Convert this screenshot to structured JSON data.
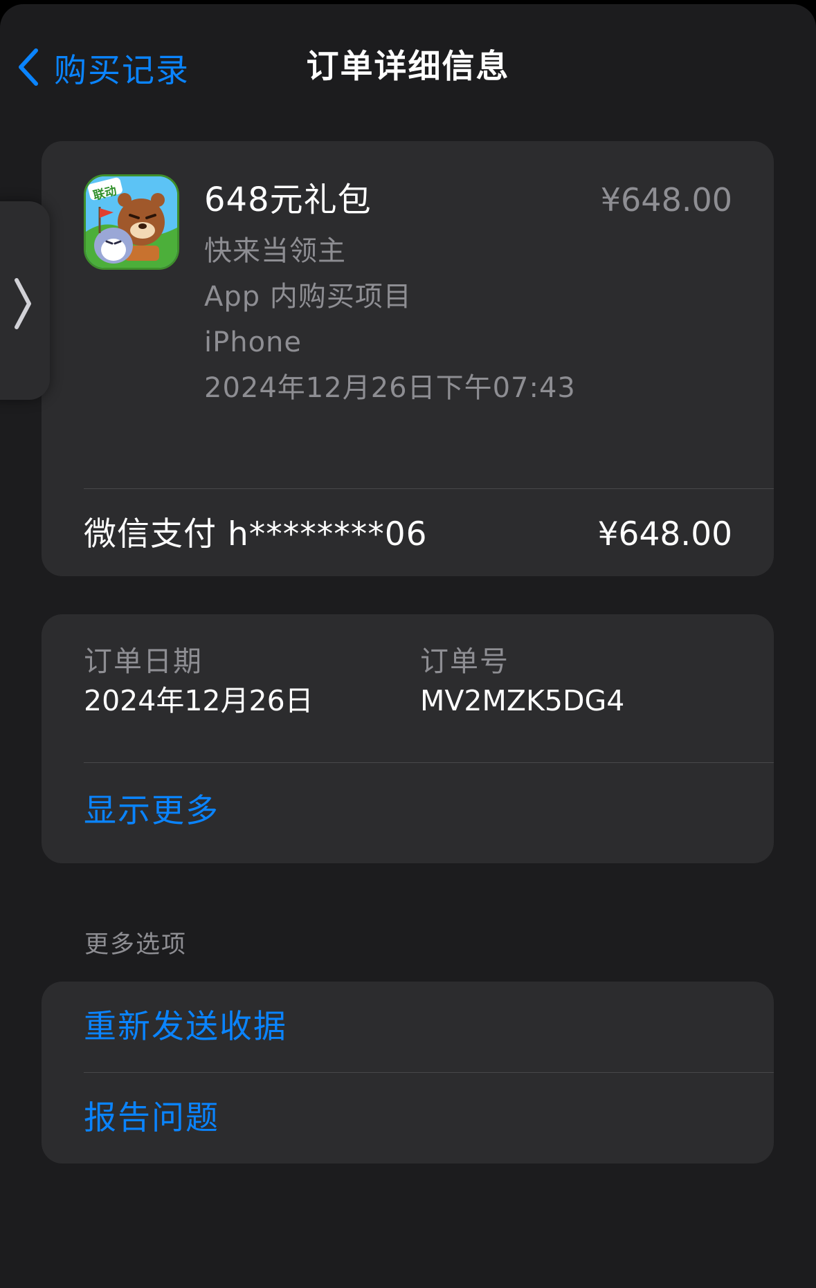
{
  "nav": {
    "back_label": "购买记录",
    "title": "订单详细信息"
  },
  "purchase": {
    "item_name": "648元礼包",
    "item_price": "¥648.00",
    "app_name": "快来当领主",
    "purchase_type": "App 内购买项目",
    "device": "iPhone",
    "datetime": "2024年12月26日下午07:43",
    "app_icon_badge": "联动"
  },
  "payment": {
    "method": "微信支付 h********06",
    "amount": "¥648.00"
  },
  "order": {
    "date_label": "订单日期",
    "date_value": "2024年12月26日",
    "id_label": "订单号",
    "id_value": "MV2MZK5DG4",
    "show_more": "显示更多"
  },
  "more_options": {
    "header": "更多选项",
    "items": [
      {
        "label": "重新发送收据"
      },
      {
        "label": "报告问题"
      }
    ]
  },
  "icons": {
    "back": "chevron-left-icon",
    "side_handle": "chevron-right-icon"
  },
  "colors": {
    "accent": "#0a84ff",
    "background": "#1c1c1e",
    "card": "#2c2c2e",
    "secondary_text": "#8e8e93"
  }
}
